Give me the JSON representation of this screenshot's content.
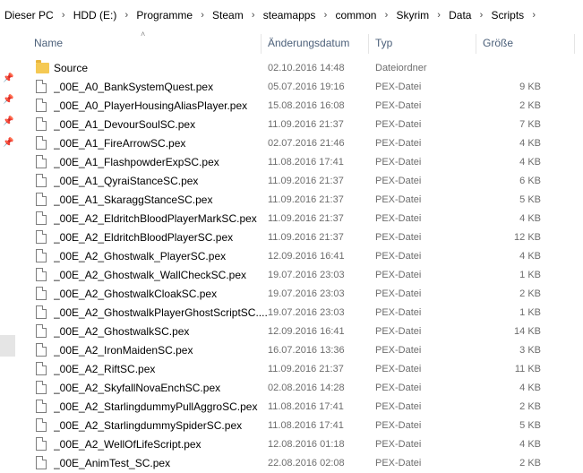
{
  "breadcrumb": [
    "Dieser PC",
    "HDD (E:)",
    "Programme",
    "Steam",
    "steamapps",
    "common",
    "Skyrim",
    "Data",
    "Scripts"
  ],
  "columns": {
    "name": "Name",
    "date": "Änderungsdatum",
    "type": "Typ",
    "size": "Größe"
  },
  "files": [
    {
      "name": "Source",
      "date": "02.10.2016 14:48",
      "type": "Dateiordner",
      "size": "",
      "icon": "folder-icon"
    },
    {
      "name": "_00E_A0_BankSystemQuest.pex",
      "date": "05.07.2016 19:16",
      "type": "PEX-Datei",
      "size": "9 KB",
      "icon": "file-icon"
    },
    {
      "name": "_00E_A0_PlayerHousingAliasPlayer.pex",
      "date": "15.08.2016 16:08",
      "type": "PEX-Datei",
      "size": "2 KB",
      "icon": "file-icon"
    },
    {
      "name": "_00E_A1_DevourSoulSC.pex",
      "date": "11.09.2016 21:37",
      "type": "PEX-Datei",
      "size": "7 KB",
      "icon": "file-icon"
    },
    {
      "name": "_00E_A1_FireArrowSC.pex",
      "date": "02.07.2016 21:46",
      "type": "PEX-Datei",
      "size": "4 KB",
      "icon": "file-icon"
    },
    {
      "name": "_00E_A1_FlashpowderExpSC.pex",
      "date": "11.08.2016 17:41",
      "type": "PEX-Datei",
      "size": "4 KB",
      "icon": "file-icon"
    },
    {
      "name": "_00E_A1_QyraiStanceSC.pex",
      "date": "11.09.2016 21:37",
      "type": "PEX-Datei",
      "size": "6 KB",
      "icon": "file-icon"
    },
    {
      "name": "_00E_A1_SkaraggStanceSC.pex",
      "date": "11.09.2016 21:37",
      "type": "PEX-Datei",
      "size": "5 KB",
      "icon": "file-icon"
    },
    {
      "name": "_00E_A2_EldritchBloodPlayerMarkSC.pex",
      "date": "11.09.2016 21:37",
      "type": "PEX-Datei",
      "size": "4 KB",
      "icon": "file-icon"
    },
    {
      "name": "_00E_A2_EldritchBloodPlayerSC.pex",
      "date": "11.09.2016 21:37",
      "type": "PEX-Datei",
      "size": "12 KB",
      "icon": "file-icon"
    },
    {
      "name": "_00E_A2_Ghostwalk_PlayerSC.pex",
      "date": "12.09.2016 16:41",
      "type": "PEX-Datei",
      "size": "4 KB",
      "icon": "file-icon"
    },
    {
      "name": "_00E_A2_Ghostwalk_WallCheckSC.pex",
      "date": "19.07.2016 23:03",
      "type": "PEX-Datei",
      "size": "1 KB",
      "icon": "file-icon"
    },
    {
      "name": "_00E_A2_GhostwalkCloakSC.pex",
      "date": "19.07.2016 23:03",
      "type": "PEX-Datei",
      "size": "2 KB",
      "icon": "file-icon"
    },
    {
      "name": "_00E_A2_GhostwalkPlayerGhostScriptSC....",
      "date": "19.07.2016 23:03",
      "type": "PEX-Datei",
      "size": "1 KB",
      "icon": "file-icon"
    },
    {
      "name": "_00E_A2_GhostwalkSC.pex",
      "date": "12.09.2016 16:41",
      "type": "PEX-Datei",
      "size": "14 KB",
      "icon": "file-icon"
    },
    {
      "name": "_00E_A2_IronMaidenSC.pex",
      "date": "16.07.2016 13:36",
      "type": "PEX-Datei",
      "size": "3 KB",
      "icon": "file-icon"
    },
    {
      "name": "_00E_A2_RiftSC.pex",
      "date": "11.09.2016 21:37",
      "type": "PEX-Datei",
      "size": "11 KB",
      "icon": "file-icon"
    },
    {
      "name": "_00E_A2_SkyfallNovaEnchSC.pex",
      "date": "02.08.2016 14:28",
      "type": "PEX-Datei",
      "size": "4 KB",
      "icon": "file-icon"
    },
    {
      "name": "_00E_A2_StarlingdummyPullAggroSC.pex",
      "date": "11.08.2016 17:41",
      "type": "PEX-Datei",
      "size": "2 KB",
      "icon": "file-icon"
    },
    {
      "name": "_00E_A2_StarlingdummySpiderSC.pex",
      "date": "11.08.2016 17:41",
      "type": "PEX-Datei",
      "size": "5 KB",
      "icon": "file-icon"
    },
    {
      "name": "_00E_A2_WellOfLifeScript.pex",
      "date": "12.08.2016 01:18",
      "type": "PEX-Datei",
      "size": "4 KB",
      "icon": "file-icon"
    },
    {
      "name": "_00E_AnimTest_SC.pex",
      "date": "22.08.2016 02:08",
      "type": "PEX-Datei",
      "size": "2 KB",
      "icon": "file-icon"
    }
  ],
  "icons": {
    "breadcrumb_separator": "chevron-right-icon",
    "sort_indicator": "sort-up-icon",
    "quick_access_pins": [
      "pin-icon",
      "pin-icon",
      "pin-icon",
      "pin-icon"
    ]
  },
  "colors": {
    "header_text": "#4c607a",
    "meta_text": "#6d6d6d",
    "folder": "#f5c953"
  }
}
